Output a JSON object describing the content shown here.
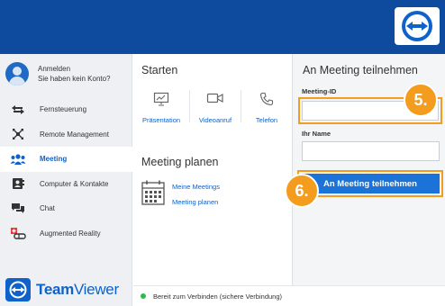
{
  "account": {
    "line1": "Anmelden",
    "line2": "Sie haben kein Konto?"
  },
  "sidebar": {
    "items": [
      {
        "label": "Fernsteuerung",
        "icon": "arrows-swap-icon"
      },
      {
        "label": "Remote Management",
        "icon": "remote-management-icon"
      },
      {
        "label": "Meeting",
        "icon": "meeting-people-icon",
        "active": true
      },
      {
        "label": "Computer & Kontakte",
        "icon": "contacts-icon"
      },
      {
        "label": "Chat",
        "icon": "chat-bubbles-icon"
      },
      {
        "label": "Augmented Reality",
        "icon": "augmented-reality-icon"
      }
    ]
  },
  "brand": {
    "name_bold": "Team",
    "name_regular": "Viewer"
  },
  "start": {
    "title": "Starten",
    "tiles": [
      {
        "label": "Präsentation",
        "icon": "presentation-icon"
      },
      {
        "label": "Videoanruf",
        "icon": "video-camera-icon"
      },
      {
        "label": "Telefon",
        "icon": "phone-icon"
      }
    ]
  },
  "plan": {
    "title": "Meeting planen",
    "links": [
      "Meine Meetings",
      "Meeting planen"
    ]
  },
  "join": {
    "title": "An Meeting teilnehmen",
    "meeting_id_label": "Meeting-ID",
    "meeting_id_value": "",
    "name_label": "Ihr Name",
    "name_value": "",
    "button_label": "An Meeting teilnehmen"
  },
  "badges": {
    "step5": "5.",
    "step6": "6."
  },
  "status": {
    "text": "Bereit zum Verbinden (sichere Verbindung)",
    "color": "#2dbb4e"
  },
  "colors": {
    "brand_blue": "#0e4a9e",
    "accent_blue": "#0e62c9",
    "button_blue": "#1b73d8",
    "highlight_orange": "#f39c1e"
  }
}
